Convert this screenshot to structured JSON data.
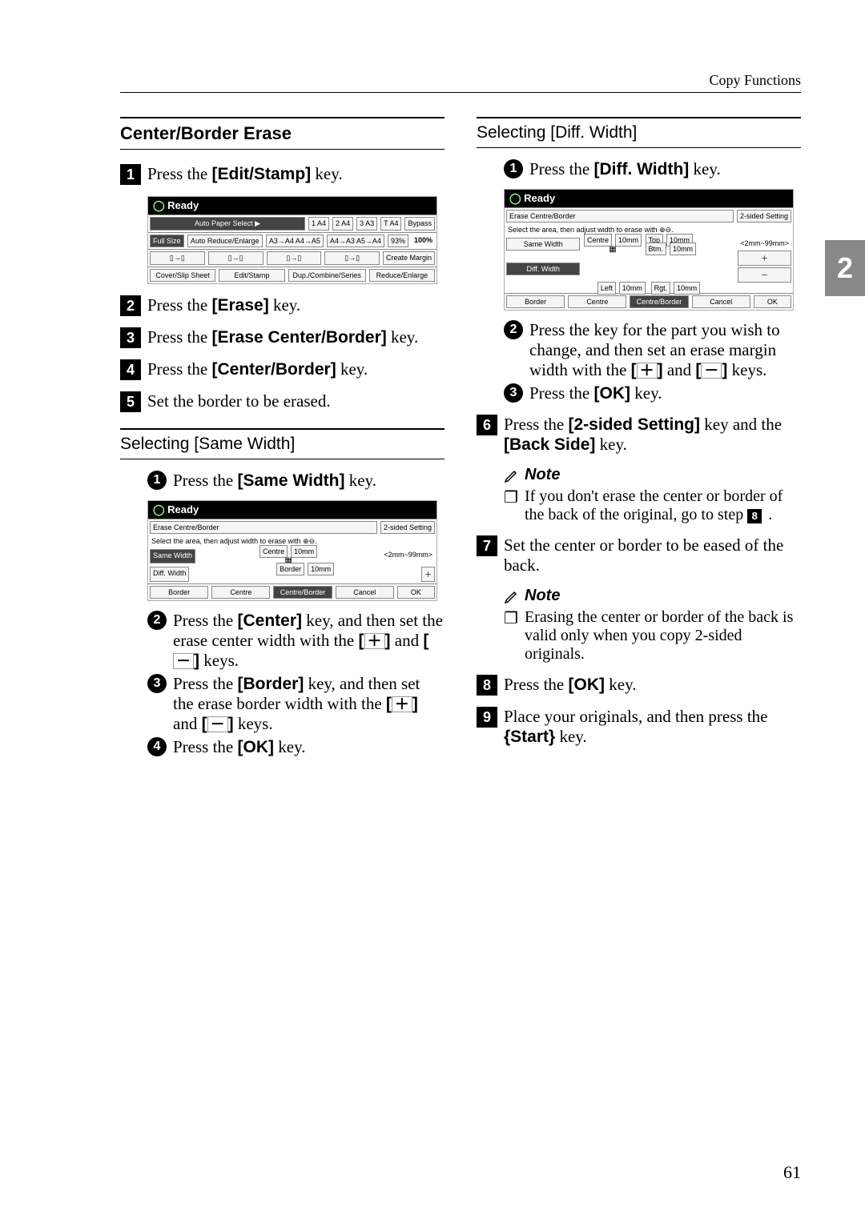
{
  "header": {
    "breadcrumb": "Copy Functions"
  },
  "page_number": "61",
  "chapter_tab": "2",
  "left": {
    "section_title": "Center/Border Erase",
    "steps": {
      "s1": "Press the [Edit/Stamp] key.",
      "s2": "Press the [Erase] key.",
      "s3": "Press the [Erase Center/Border] key.",
      "s4": "Press the [Center/Border] key.",
      "s5": "Set the border to be erased."
    },
    "sub_title": "Selecting [Same Width]",
    "sub_steps": {
      "a1": "Press the [Same Width] key.",
      "a2": "Press the [Center] key, and then set the erase center width with the [＋] and [－] keys.",
      "a3": "Press the [Border] key, and then set the erase border width with the [＋] and [－] keys.",
      "a4": "Press the [OK] key."
    },
    "ss1": {
      "ready": "Ready",
      "auto_paper": "Auto Paper Select ▶",
      "p1": "1 A4",
      "p2": "2 A4",
      "p3": "3 A3",
      "p4": "T A4",
      "bypass": "Bypass",
      "full_size": "Full Size",
      "are": "Auto Reduce/Enlarge",
      "r1": "A3→A4 A4→A5",
      "r2": "A4→A3 A5→A4",
      "pct": "93%",
      "pct2": "100%",
      "create": "Create Margin",
      "cover": "Cover/Slip Sheet",
      "edit": "Edit/Stamp",
      "dup": "Dup./Combine/Series",
      "red": "Reduce/Enlarge"
    },
    "ss2": {
      "ready": "Ready",
      "title2": "Erase Centre/Border",
      "twos": "2-sided Setting",
      "instr": "Select the area, then adjust width to erase with ⊕⊖.",
      "centre": "Centre",
      "val": "10mm",
      "range": "<2mm~99mm>",
      "same": "Same Width",
      "diff": "Diff. Width",
      "border_val": "Border",
      "bv": "10mm",
      "btm_border": "Border",
      "btm_centre": "Centre",
      "btm_cb": "Centre/Border",
      "cancel": "Cancel",
      "ok": "OK"
    }
  },
  "right": {
    "sub_title": "Selecting [Diff. Width]",
    "sub_steps": {
      "b1": "Press the [Diff. Width] key.",
      "b2": "Press the key for the part you wish to change, and then set an erase margin width with the [＋] and [－] keys.",
      "b3": "Press the [OK] key."
    },
    "ss3": {
      "ready": "Ready",
      "title2": "Erase Centre/Border",
      "twos": "2-sided Setting",
      "instr": "Select the area, then adjust width to erase with ⊕⊖.",
      "centre": "Centre",
      "val": "10mm",
      "range": "<2mm~99mm>",
      "same": "Same Width",
      "diff": "Diff. Width",
      "top": "Top",
      "tv": "10mm",
      "btm": "Btm.",
      "bv": "10mm",
      "left": "Left",
      "lv": "10mm",
      "rgt": "Rgt.",
      "rv": "10mm",
      "plus": "＋",
      "minus": "－",
      "btm_border": "Border",
      "btm_centre": "Centre",
      "btm_cb": "Centre/Border",
      "cancel": "Cancel",
      "ok": "OK"
    },
    "steps": {
      "s6": "Press the [2-sided Setting] key and the [Back Side] key.",
      "s7": "Set the center or border to be eased of the back.",
      "s8": "Press the [OK] key.",
      "s9": "Place your originals, and then press the {Start} key."
    },
    "note_label": "Note",
    "note1": "If you don't erase the center or border of the back of the original, go to step ",
    "note1_ref": "8",
    "note2": "Erasing the center or border of the back is valid only when you copy 2-sided originals."
  }
}
